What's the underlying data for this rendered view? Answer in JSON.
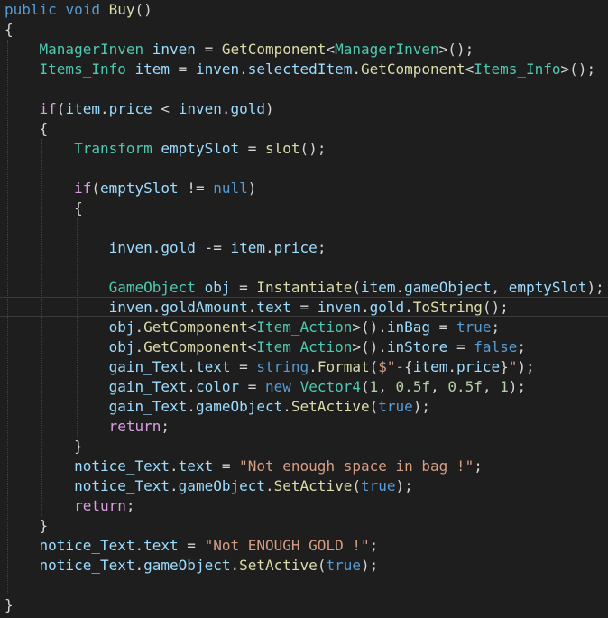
{
  "editor": {
    "language": "C#",
    "theme": "dark",
    "colors": {
      "background": "#1e1e1e",
      "keyword": "#569cd6",
      "type": "#4ec9b0",
      "method": "#dcdcaa",
      "variable": "#9cdcfe",
      "string": "#d69d85",
      "number": "#b5cea8",
      "control": "#d8a0df",
      "plain": "#d4d4d4"
    },
    "lines": [
      [
        [
          "kw",
          "public"
        ],
        [
          "pl",
          " "
        ],
        [
          "kw",
          "void"
        ],
        [
          "pl",
          " "
        ],
        [
          "fn",
          "Buy"
        ],
        [
          "pl",
          "()"
        ]
      ],
      [
        [
          "pl",
          "{"
        ]
      ],
      [
        [
          "pl",
          "    "
        ],
        [
          "ty",
          "ManagerInven"
        ],
        [
          "pl",
          " "
        ],
        [
          "var",
          "inven"
        ],
        [
          "pl",
          " = "
        ],
        [
          "fn",
          "GetComponent"
        ],
        [
          "pl",
          "<"
        ],
        [
          "ty",
          "ManagerInven"
        ],
        [
          "pl",
          ">();"
        ]
      ],
      [
        [
          "pl",
          "    "
        ],
        [
          "ty",
          "Items_Info"
        ],
        [
          "pl",
          " "
        ],
        [
          "var",
          "item"
        ],
        [
          "pl",
          " = "
        ],
        [
          "var",
          "inven"
        ],
        [
          "pl",
          "."
        ],
        [
          "var",
          "selectedItem"
        ],
        [
          "pl",
          "."
        ],
        [
          "fn",
          "GetComponent"
        ],
        [
          "pl",
          "<"
        ],
        [
          "ty",
          "Items_Info"
        ],
        [
          "pl",
          ">();"
        ]
      ],
      [],
      [
        [
          "pl",
          "    "
        ],
        [
          "ctl",
          "if"
        ],
        [
          "pl",
          "("
        ],
        [
          "var",
          "item"
        ],
        [
          "pl",
          "."
        ],
        [
          "var",
          "price"
        ],
        [
          "pl",
          " < "
        ],
        [
          "var",
          "inven"
        ],
        [
          "pl",
          "."
        ],
        [
          "var",
          "gold"
        ],
        [
          "pl",
          ")"
        ]
      ],
      [
        [
          "pl",
          "    {"
        ]
      ],
      [
        [
          "pl",
          "        "
        ],
        [
          "ty",
          "Transform"
        ],
        [
          "pl",
          " "
        ],
        [
          "var",
          "emptySlot"
        ],
        [
          "pl",
          " = "
        ],
        [
          "fn",
          "slot"
        ],
        [
          "pl",
          "();"
        ]
      ],
      [],
      [
        [
          "pl",
          "        "
        ],
        [
          "ctl",
          "if"
        ],
        [
          "pl",
          "("
        ],
        [
          "var",
          "emptySlot"
        ],
        [
          "pl",
          " != "
        ],
        [
          "kw",
          "null"
        ],
        [
          "pl",
          ")"
        ]
      ],
      [
        [
          "pl",
          "        {"
        ]
      ],
      [],
      [
        [
          "pl",
          "            "
        ],
        [
          "var",
          "inven"
        ],
        [
          "pl",
          "."
        ],
        [
          "var",
          "gold"
        ],
        [
          "pl",
          " -= "
        ],
        [
          "var",
          "item"
        ],
        [
          "pl",
          "."
        ],
        [
          "var",
          "price"
        ],
        [
          "pl",
          ";"
        ]
      ],
      [],
      [
        [
          "pl",
          "            "
        ],
        [
          "ty",
          "GameObject"
        ],
        [
          "pl",
          " "
        ],
        [
          "var",
          "obj"
        ],
        [
          "pl",
          " = "
        ],
        [
          "fn",
          "Instantiate"
        ],
        [
          "pl",
          "("
        ],
        [
          "var",
          "item"
        ],
        [
          "pl",
          "."
        ],
        [
          "var",
          "gameObject"
        ],
        [
          "pl",
          ", "
        ],
        [
          "var",
          "emptySlot"
        ],
        [
          "pl",
          ");"
        ]
      ],
      [
        [
          "pl",
          "            "
        ],
        [
          "var",
          "inven"
        ],
        [
          "pl",
          "."
        ],
        [
          "var",
          "goldAmount"
        ],
        [
          "pl",
          "."
        ],
        [
          "var",
          "text"
        ],
        [
          "pl",
          " = "
        ],
        [
          "var",
          "inven"
        ],
        [
          "pl",
          "."
        ],
        [
          "var",
          "gold"
        ],
        [
          "pl",
          "."
        ],
        [
          "fn",
          "ToString"
        ],
        [
          "pl",
          "();"
        ]
      ],
      [
        [
          "pl",
          "            "
        ],
        [
          "var",
          "obj"
        ],
        [
          "pl",
          "."
        ],
        [
          "fn",
          "GetComponent"
        ],
        [
          "pl",
          "<"
        ],
        [
          "ty",
          "Item_Action"
        ],
        [
          "pl",
          ">()."
        ],
        [
          "var",
          "inBag"
        ],
        [
          "pl",
          " = "
        ],
        [
          "kw",
          "true"
        ],
        [
          "pl",
          ";"
        ]
      ],
      [
        [
          "pl",
          "            "
        ],
        [
          "var",
          "obj"
        ],
        [
          "pl",
          "."
        ],
        [
          "fn",
          "GetComponent"
        ],
        [
          "pl",
          "<"
        ],
        [
          "ty",
          "Item_Action"
        ],
        [
          "pl",
          ">()."
        ],
        [
          "var",
          "inStore"
        ],
        [
          "pl",
          " = "
        ],
        [
          "kw",
          "false"
        ],
        [
          "pl",
          ";"
        ]
      ],
      [
        [
          "pl",
          "            "
        ],
        [
          "var",
          "gain_Text"
        ],
        [
          "pl",
          "."
        ],
        [
          "var",
          "text"
        ],
        [
          "pl",
          " = "
        ],
        [
          "kw",
          "string"
        ],
        [
          "pl",
          "."
        ],
        [
          "fn",
          "Format"
        ],
        [
          "pl",
          "("
        ],
        [
          "str",
          "$\"-"
        ],
        [
          "pl",
          "{"
        ],
        [
          "var",
          "item"
        ],
        [
          "pl",
          "."
        ],
        [
          "var",
          "price"
        ],
        [
          "pl",
          "}"
        ],
        [
          "str",
          "\""
        ],
        [
          "pl",
          ");"
        ]
      ],
      [
        [
          "pl",
          "            "
        ],
        [
          "var",
          "gain_Text"
        ],
        [
          "pl",
          "."
        ],
        [
          "var",
          "color"
        ],
        [
          "pl",
          " = "
        ],
        [
          "kw",
          "new"
        ],
        [
          "pl",
          " "
        ],
        [
          "ty",
          "Vector4"
        ],
        [
          "pl",
          "("
        ],
        [
          "num",
          "1"
        ],
        [
          "pl",
          ", "
        ],
        [
          "num",
          "0.5f"
        ],
        [
          "pl",
          ", "
        ],
        [
          "num",
          "0.5f"
        ],
        [
          "pl",
          ", "
        ],
        [
          "num",
          "1"
        ],
        [
          "pl",
          ");"
        ]
      ],
      [
        [
          "pl",
          "            "
        ],
        [
          "var",
          "gain_Text"
        ],
        [
          "pl",
          "."
        ],
        [
          "var",
          "gameObject"
        ],
        [
          "pl",
          "."
        ],
        [
          "fn",
          "SetActive"
        ],
        [
          "pl",
          "("
        ],
        [
          "kw",
          "true"
        ],
        [
          "pl",
          ");"
        ]
      ],
      [
        [
          "pl",
          "            "
        ],
        [
          "ctl",
          "return"
        ],
        [
          "pl",
          ";"
        ]
      ],
      [
        [
          "pl",
          "        }"
        ]
      ],
      [
        [
          "pl",
          "        "
        ],
        [
          "var",
          "notice_Text"
        ],
        [
          "pl",
          "."
        ],
        [
          "var",
          "text"
        ],
        [
          "pl",
          " = "
        ],
        [
          "str",
          "\"Not enough space in bag !\""
        ],
        [
          "pl",
          ";"
        ]
      ],
      [
        [
          "pl",
          "        "
        ],
        [
          "var",
          "notice_Text"
        ],
        [
          "pl",
          "."
        ],
        [
          "var",
          "gameObject"
        ],
        [
          "pl",
          "."
        ],
        [
          "fn",
          "SetActive"
        ],
        [
          "pl",
          "("
        ],
        [
          "kw",
          "true"
        ],
        [
          "pl",
          ");"
        ]
      ],
      [
        [
          "pl",
          "        "
        ],
        [
          "ctl",
          "return"
        ],
        [
          "pl",
          ";"
        ]
      ],
      [
        [
          "pl",
          "    }"
        ]
      ],
      [
        [
          "pl",
          "    "
        ],
        [
          "var",
          "notice_Text"
        ],
        [
          "pl",
          "."
        ],
        [
          "var",
          "text"
        ],
        [
          "pl",
          " = "
        ],
        [
          "str",
          "\"Not ENOUGH GOLD !\""
        ],
        [
          "pl",
          ";"
        ]
      ],
      [
        [
          "pl",
          "    "
        ],
        [
          "var",
          "notice_Text"
        ],
        [
          "pl",
          "."
        ],
        [
          "var",
          "gameObject"
        ],
        [
          "pl",
          "."
        ],
        [
          "fn",
          "SetActive"
        ],
        [
          "pl",
          "("
        ],
        [
          "kw",
          "true"
        ],
        [
          "pl",
          ");"
        ]
      ],
      [],
      [
        [
          "pl",
          "}"
        ]
      ]
    ]
  }
}
